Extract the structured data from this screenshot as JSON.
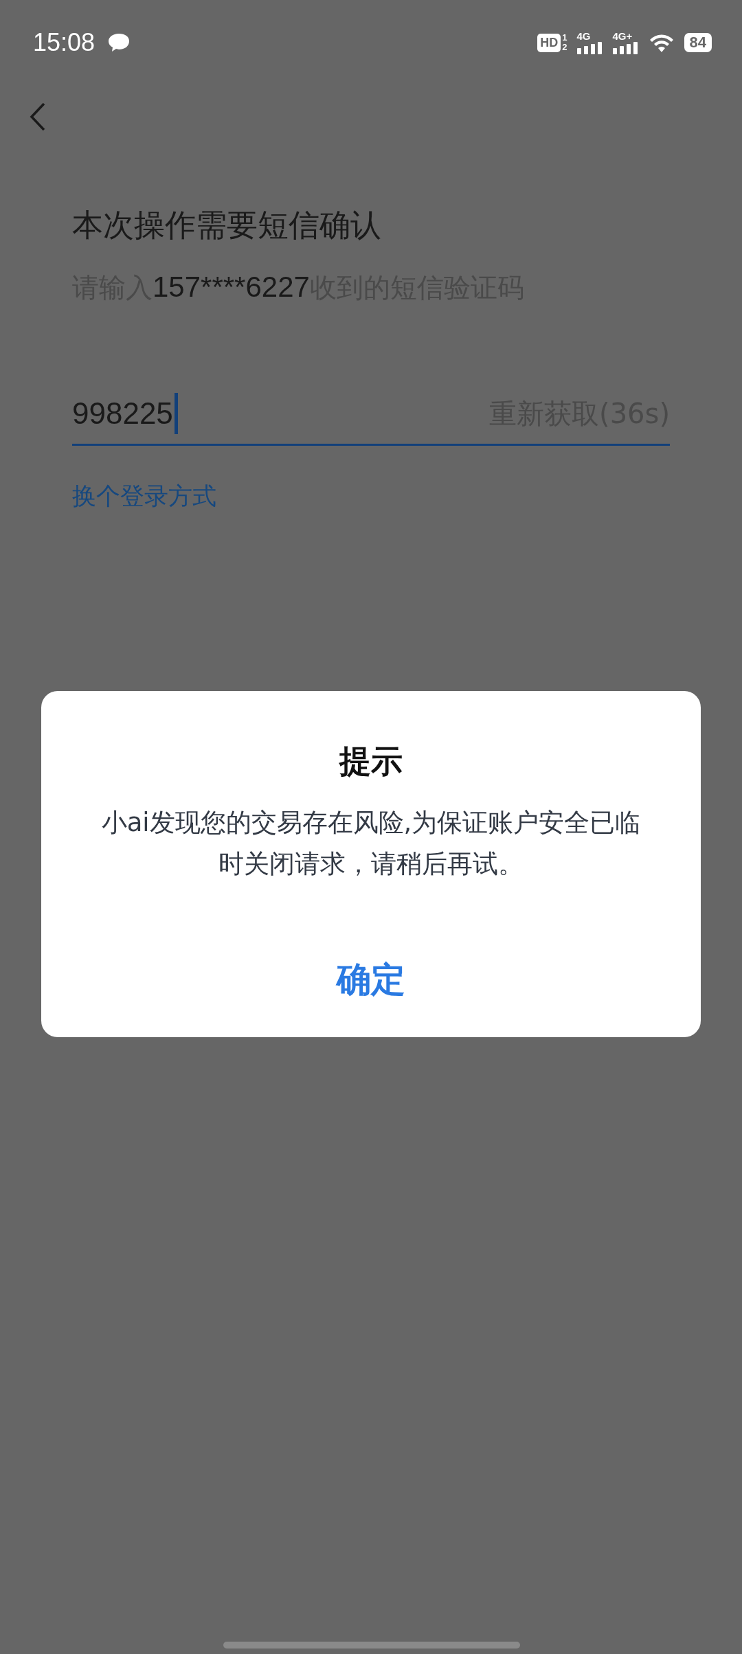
{
  "status_bar": {
    "time": "15:08",
    "hd_label": "HD",
    "hd_sup": "1",
    "hd_sub": "2",
    "sim1_label": "4G",
    "sim2_label": "4G+",
    "battery": "84"
  },
  "title": "本次操作需要短信确认",
  "hint": {
    "prefix": "请输入",
    "phone": "157****6227",
    "suffix": "收到的短信验证码"
  },
  "code_field": {
    "value": "998225",
    "focused": true
  },
  "resend_button": "重新获取(36s)",
  "switch_login_link": "换个登录方式",
  "dialog": {
    "title": "提示",
    "message": "小ai发现您的交易存在风险,为保证账户安全已临时关闭请求，请稍后再试。",
    "button": "确定"
  }
}
